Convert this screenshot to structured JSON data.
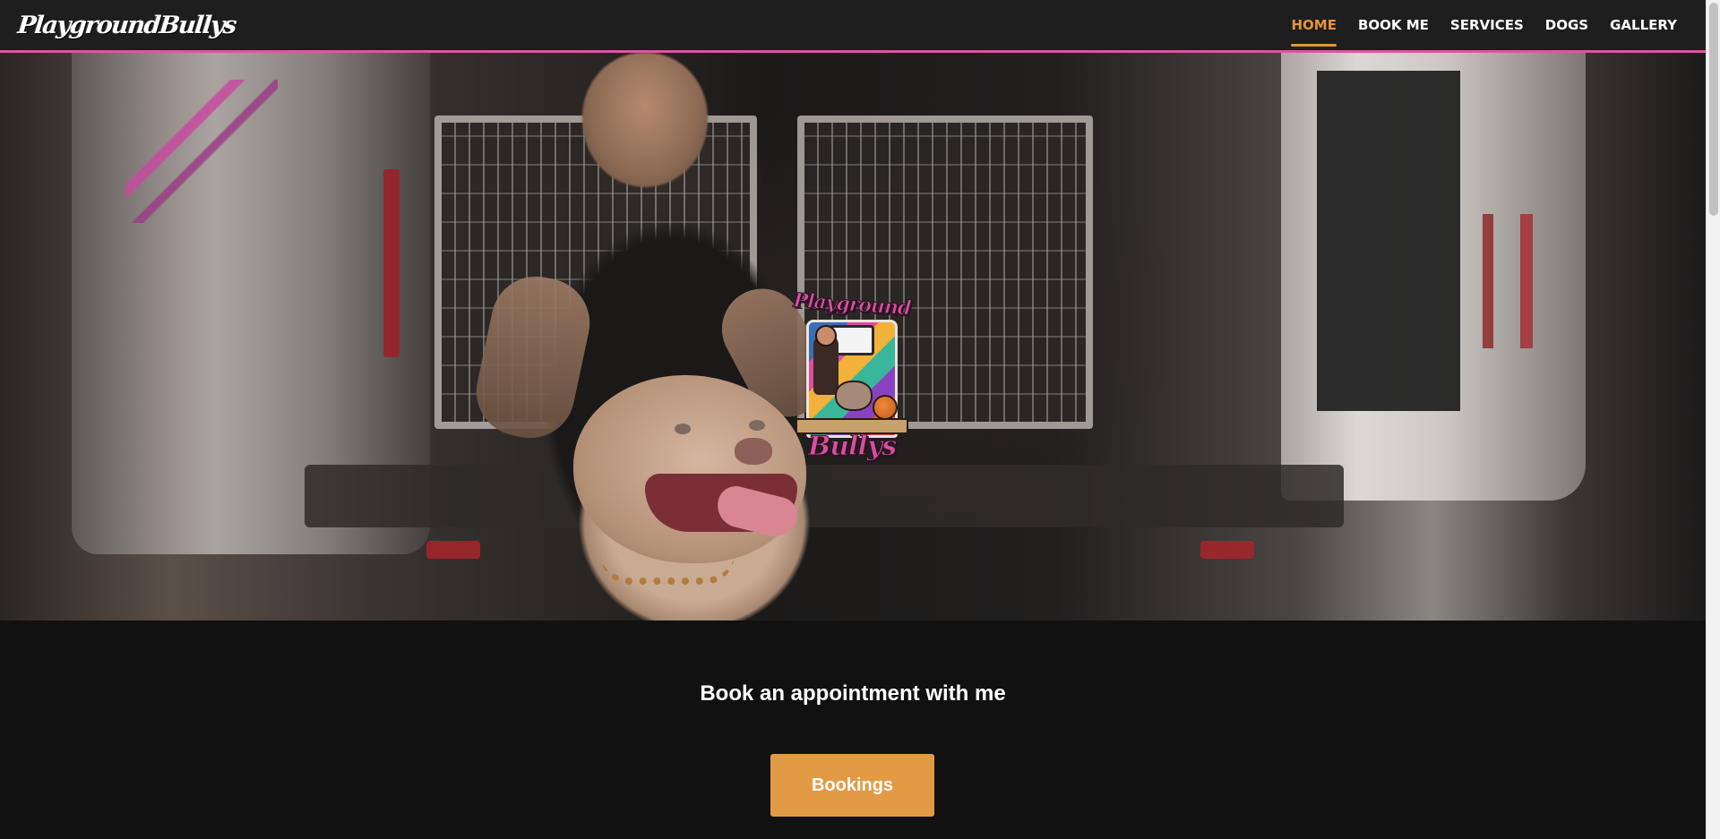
{
  "header": {
    "brand": "PlaygroundBullys",
    "accent_color": "#e5953a",
    "border_color": "#d957a6"
  },
  "nav": {
    "items": [
      {
        "label": "HOME",
        "active": true
      },
      {
        "label": "BOOK ME",
        "active": false
      },
      {
        "label": "SERVICES",
        "active": false
      },
      {
        "label": "DOGS",
        "active": false
      },
      {
        "label": "GALLERY",
        "active": false
      }
    ]
  },
  "hero": {
    "badge_title": "Playground",
    "badge_foot": "Bullys"
  },
  "cta": {
    "heading": "Book an appointment with me",
    "button_label": "Bookings",
    "button_color": "#e39a45"
  }
}
